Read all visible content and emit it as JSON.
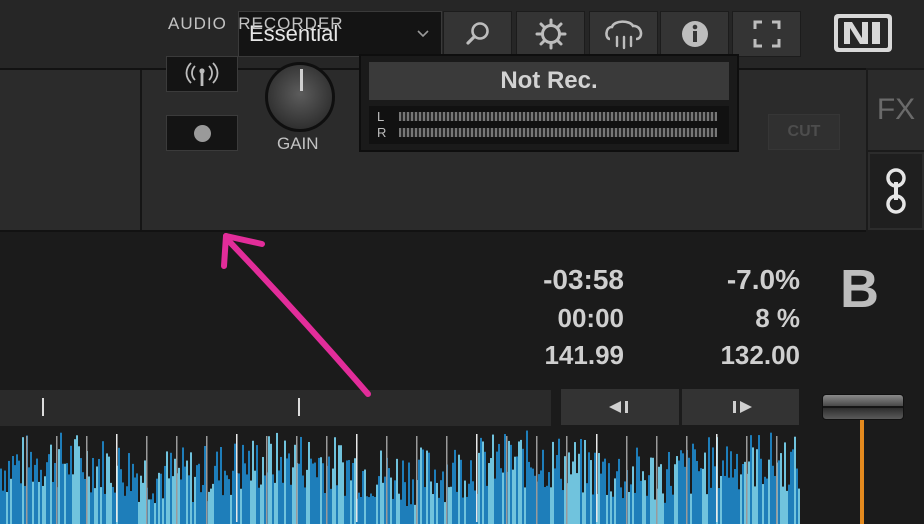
{
  "toolbar": {
    "layout_value": "Essential",
    "buttons": [
      "search-icon",
      "gear-icon",
      "loop-cloud-icon",
      "info-icon",
      "fullscreen-icon"
    ],
    "logo_text": "NI"
  },
  "recorder": {
    "title": "AUDIO  RECORDER",
    "gain_label": "GAIN",
    "status": "Not Rec.",
    "meter_left": "L",
    "meter_right": "R",
    "cut_label": "CUT"
  },
  "side": {
    "fx_label": "FX"
  },
  "deck": {
    "letter": "B",
    "remaining_time": "-03:58",
    "elapsed_time": "00:00",
    "bpm": "141.99",
    "tempo_offset": "-7.0%",
    "tempo_range": "8 %",
    "base_bpm": "132.00"
  },
  "colors": {
    "annotation": "#e22d9a",
    "fader": "#e48a1e",
    "waveform": "#2fb6ff"
  }
}
